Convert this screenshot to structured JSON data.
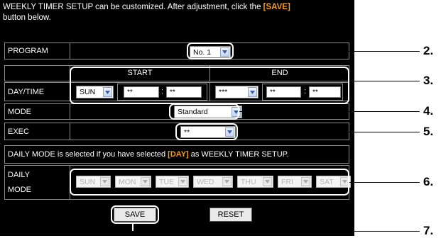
{
  "intro": {
    "text_before": "WEEKLY TIMER SETUP can be customized. After adjustment, click the ",
    "save_word": "[SAVE]",
    "text_after": " button below."
  },
  "program": {
    "label": "PROGRAM",
    "value": "No. 1"
  },
  "day_time": {
    "label": "DAY/TIME",
    "start_header": "START",
    "end_header": "END",
    "start_day": "SUN",
    "start_hour": "**",
    "start_minute": "**",
    "end_day": "***",
    "end_hour": "**",
    "end_minute": "**",
    "separator": ":"
  },
  "mode": {
    "label": "MODE",
    "value": "Standard"
  },
  "exec": {
    "label": "EXEC",
    "value": "**"
  },
  "daily_note": {
    "text_before": "DAILY MODE is selected if you have selected ",
    "day_word": "[DAY]",
    "text_after": " as WEEKLY TIMER SETUP."
  },
  "daily_mode": {
    "label_line1": "DAILY",
    "label_line2": "MODE",
    "days": [
      "SUN",
      "MON",
      "TUE",
      "WED",
      "THU",
      "FRI",
      "SAT"
    ]
  },
  "buttons": {
    "save": "SAVE",
    "reset": "RESET"
  },
  "callout_numbers": [
    "2.",
    "3.",
    "4.",
    "5.",
    "6.",
    "7."
  ],
  "colors": {
    "accent": "#f39c21",
    "panel": "#000000",
    "border": "#8c8c8c"
  },
  "icons": {
    "dropdown": "chevron-down-icon"
  }
}
